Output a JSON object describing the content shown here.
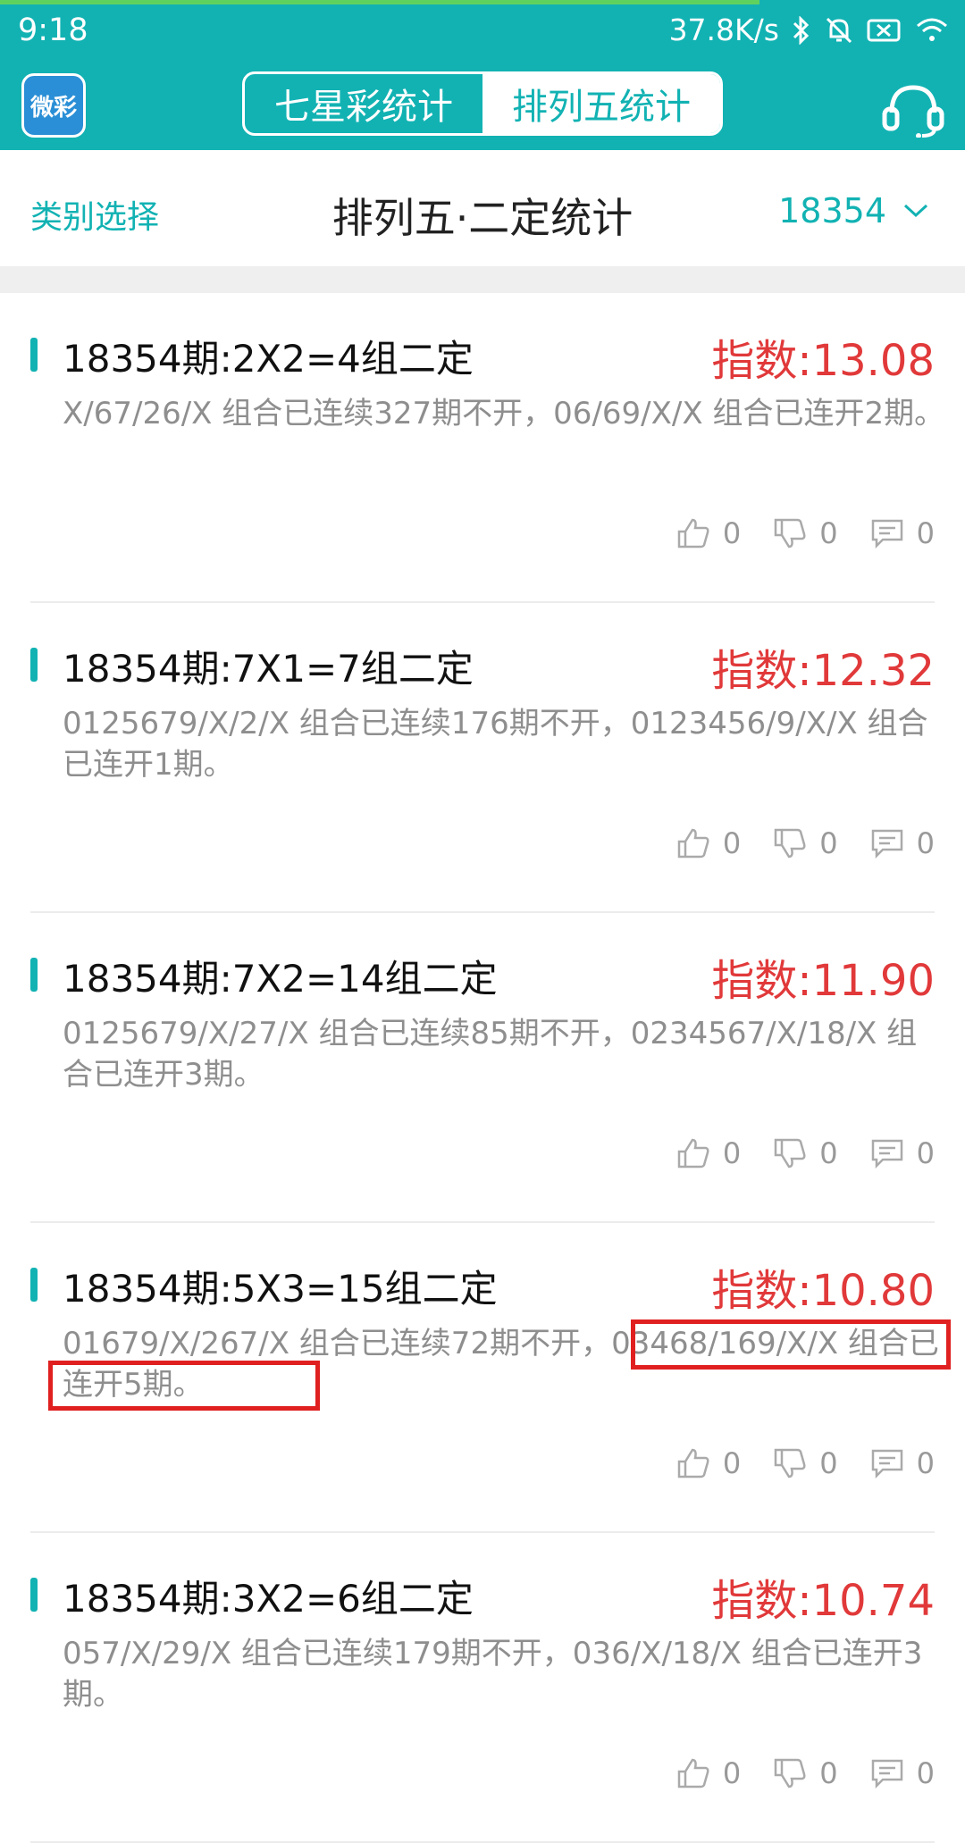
{
  "status_bar": {
    "time": "9:18",
    "net_speed": "37.8K/s"
  },
  "appbar": {
    "logo_text": "微彩",
    "tabs": [
      {
        "label": "七星彩统计",
        "active": false
      },
      {
        "label": "排列五统计",
        "active": true
      }
    ]
  },
  "subheader": {
    "category_label": "类别选择",
    "title": "排列五·二定统计",
    "issue": "18354"
  },
  "cards": [
    {
      "title": "18354期:2X2=4组二定",
      "index": "指数:13.08",
      "desc": "X/67/26/X 组合已连续327期不开，06/69/X/X 组合已连开2期。",
      "likes": "0",
      "dislikes": "0",
      "comments": "0"
    },
    {
      "title": "18354期:7X1=7组二定",
      "index": "指数:12.32",
      "desc": "0125679/X/2/X 组合已连续176期不开，0123456/9/X/X 组合已连开1期。",
      "likes": "0",
      "dislikes": "0",
      "comments": "0"
    },
    {
      "title": "18354期:7X2=14组二定",
      "index": "指数:11.90",
      "desc": "0125679/X/27/X 组合已连续85期不开，0234567/X/18/X 组合已连开3期。",
      "likes": "0",
      "dislikes": "0",
      "comments": "0"
    },
    {
      "title": "18354期:5X3=15组二定",
      "index": "指数:10.80",
      "desc": "01679/X/267/X 组合已连续72期不开，03468/169/X/X 组合已连开5期。",
      "likes": "0",
      "dislikes": "0",
      "comments": "0"
    },
    {
      "title": "18354期:3X2=6组二定",
      "index": "指数:10.74",
      "desc": "057/X/29/X 组合已连续179期不开，036/X/18/X 组合已连开3期。",
      "likes": "0",
      "dislikes": "0",
      "comments": "0"
    }
  ],
  "colors": {
    "accent": "#12b2b3",
    "index_red": "#e1393a",
    "highlight_red": "#e02020"
  }
}
